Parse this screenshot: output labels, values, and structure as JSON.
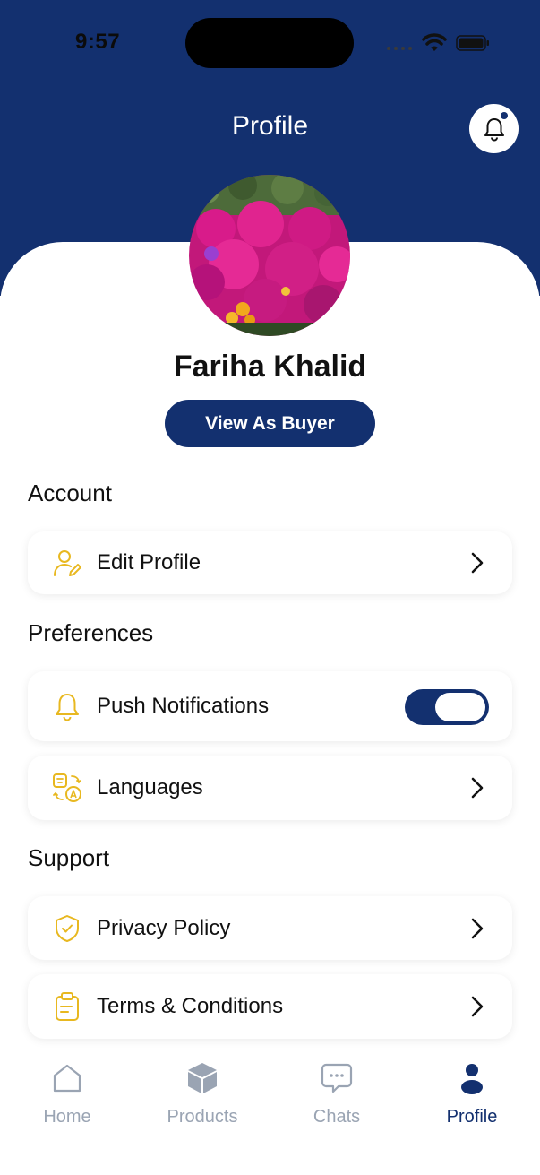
{
  "status_bar": {
    "time": "9:57"
  },
  "header": {
    "title": "Profile"
  },
  "profile": {
    "name": "Fariha Khalid",
    "view_as_buyer_label": "View As Buyer"
  },
  "sections": {
    "account": {
      "title": "Account",
      "edit_profile": "Edit Profile"
    },
    "preferences": {
      "title": "Preferences",
      "push_notifications": "Push Notifications",
      "push_enabled": true,
      "languages": "Languages"
    },
    "support": {
      "title": "Support",
      "privacy_policy": "Privacy Policy",
      "terms": "Terms & Conditions"
    }
  },
  "tabs": [
    {
      "label": "Home",
      "icon": "home-icon",
      "active": false
    },
    {
      "label": "Products",
      "icon": "box-icon",
      "active": false
    },
    {
      "label": "Chats",
      "icon": "chat-icon",
      "active": false
    },
    {
      "label": "Profile",
      "icon": "user-icon",
      "active": true
    }
  ],
  "colors": {
    "primary": "#13306f",
    "accent": "#f0c020",
    "muted": "#9aa4b3"
  }
}
